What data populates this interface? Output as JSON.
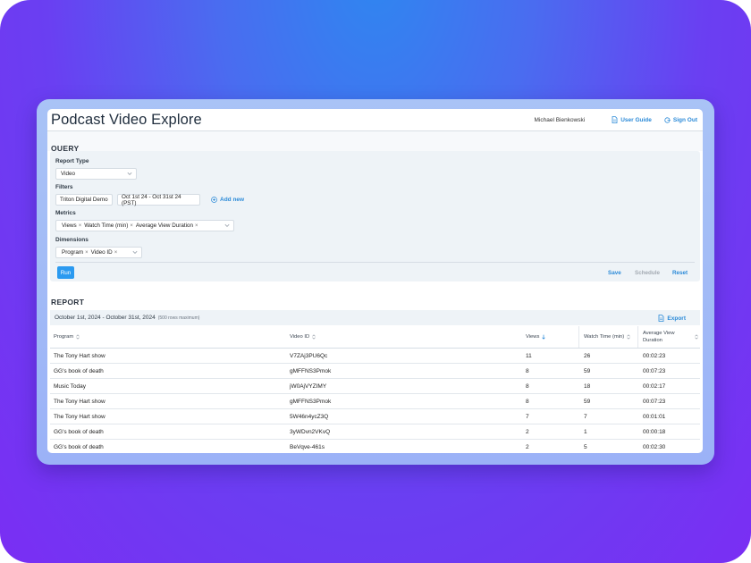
{
  "header": {
    "title": "Podcast Video Explore",
    "user_name": "Michael Bienkowski",
    "user_guide": "User Guide",
    "sign_out": "Sign Out"
  },
  "query": {
    "heading": "QUERY",
    "report_type_label": "Report Type",
    "report_type_value": "Video",
    "filters_label": "Filters",
    "filters": [
      "Triton Digital Demo",
      "Oct 1st 24 - Oct 31st 24 (PST)"
    ],
    "add_new": "Add new",
    "metrics_label": "Metrics",
    "metrics": [
      "Views",
      "Watch Time (min)",
      "Average View Duration"
    ],
    "dimensions_label": "Dimensions",
    "dimensions": [
      "Program",
      "Video ID"
    ],
    "run": "Run",
    "save": "Save",
    "schedule": "Schedule",
    "reset": "Reset"
  },
  "report": {
    "heading": "REPORT",
    "range": "October 1st, 2024 - October 31st, 2024",
    "range_note": "(500 rows maximum)",
    "export": "Export",
    "columns": [
      "Program",
      "Video ID",
      "Views",
      "Watch Time (min)",
      "Average View Duration"
    ],
    "rows": [
      [
        "The Tony Hart show",
        "V7ZAj3PU6Qc",
        "11",
        "26",
        "00:02:23"
      ],
      [
        "GG's book of death",
        "gMFFNS3Pmok",
        "8",
        "59",
        "00:07:23"
      ],
      [
        "Music Today",
        "jW0AjVYZIMY",
        "8",
        "18",
        "00:02:17"
      ],
      [
        "The Tony Hart show",
        "gMFFNS3Pmok",
        "8",
        "59",
        "00:07:23"
      ],
      [
        "The Tony Hart show",
        "5W46n4ycZ3Q",
        "7",
        "7",
        "00:01:01"
      ],
      [
        "GG's book of death",
        "3yWDvn2VKvQ",
        "2",
        "1",
        "00:00:18"
      ],
      [
        "GG's book of death",
        "BeVqve-461s",
        "2",
        "5",
        "00:02:30"
      ]
    ]
  },
  "colors": {
    "accent": "#2b8ad8",
    "run_button": "#2b9af0",
    "panel": "#eef3f7",
    "background_top": "#2f86f0",
    "background_bottom": "#7a2ef3"
  },
  "icons": {
    "user_guide": "document-icon",
    "sign_out": "sign-out-icon",
    "add_new": "plus-circle-icon",
    "export": "document-icon",
    "select": "chevron-down-icon",
    "sort": "sort-icon"
  }
}
